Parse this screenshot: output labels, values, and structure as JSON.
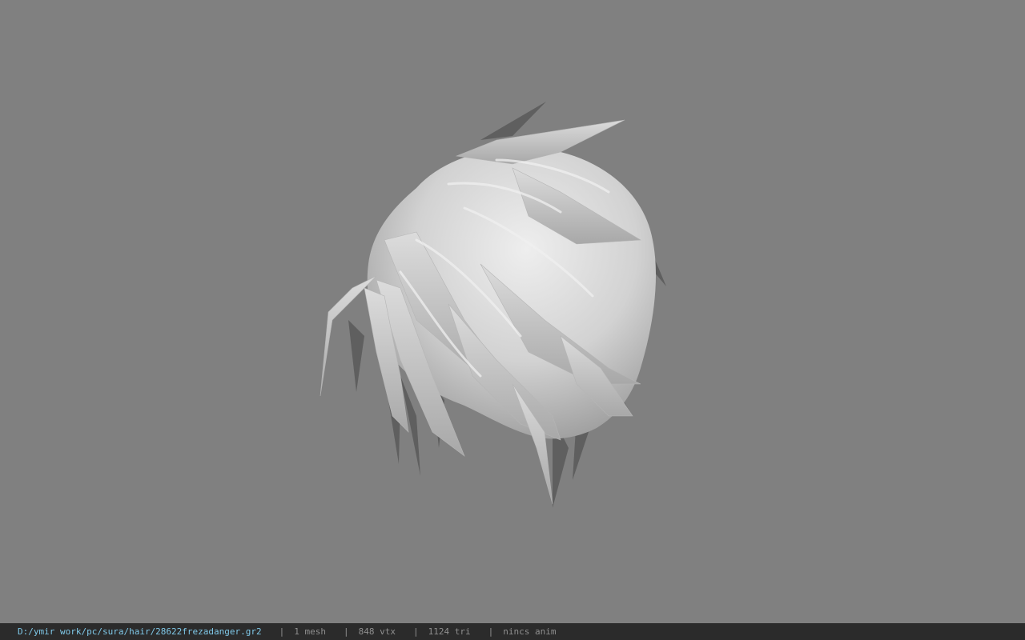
{
  "viewport": {
    "background": "#808080",
    "model": {
      "icon": "hair-mesh-model",
      "base_color": "#cfcfcf",
      "shadow_color": "#5e5e5e",
      "highlight_color": "#ececec"
    }
  },
  "statusbar": {
    "path": "D:/ymir work/pc/sura/hair/28622frezadanger.gr2",
    "separator": "|",
    "mesh": "1 mesh",
    "vertices": "848 vtx",
    "triangles": "1124 tri",
    "anim": "nincs anim",
    "background": "#2b2b2b",
    "path_color": "#7fc8e8"
  }
}
